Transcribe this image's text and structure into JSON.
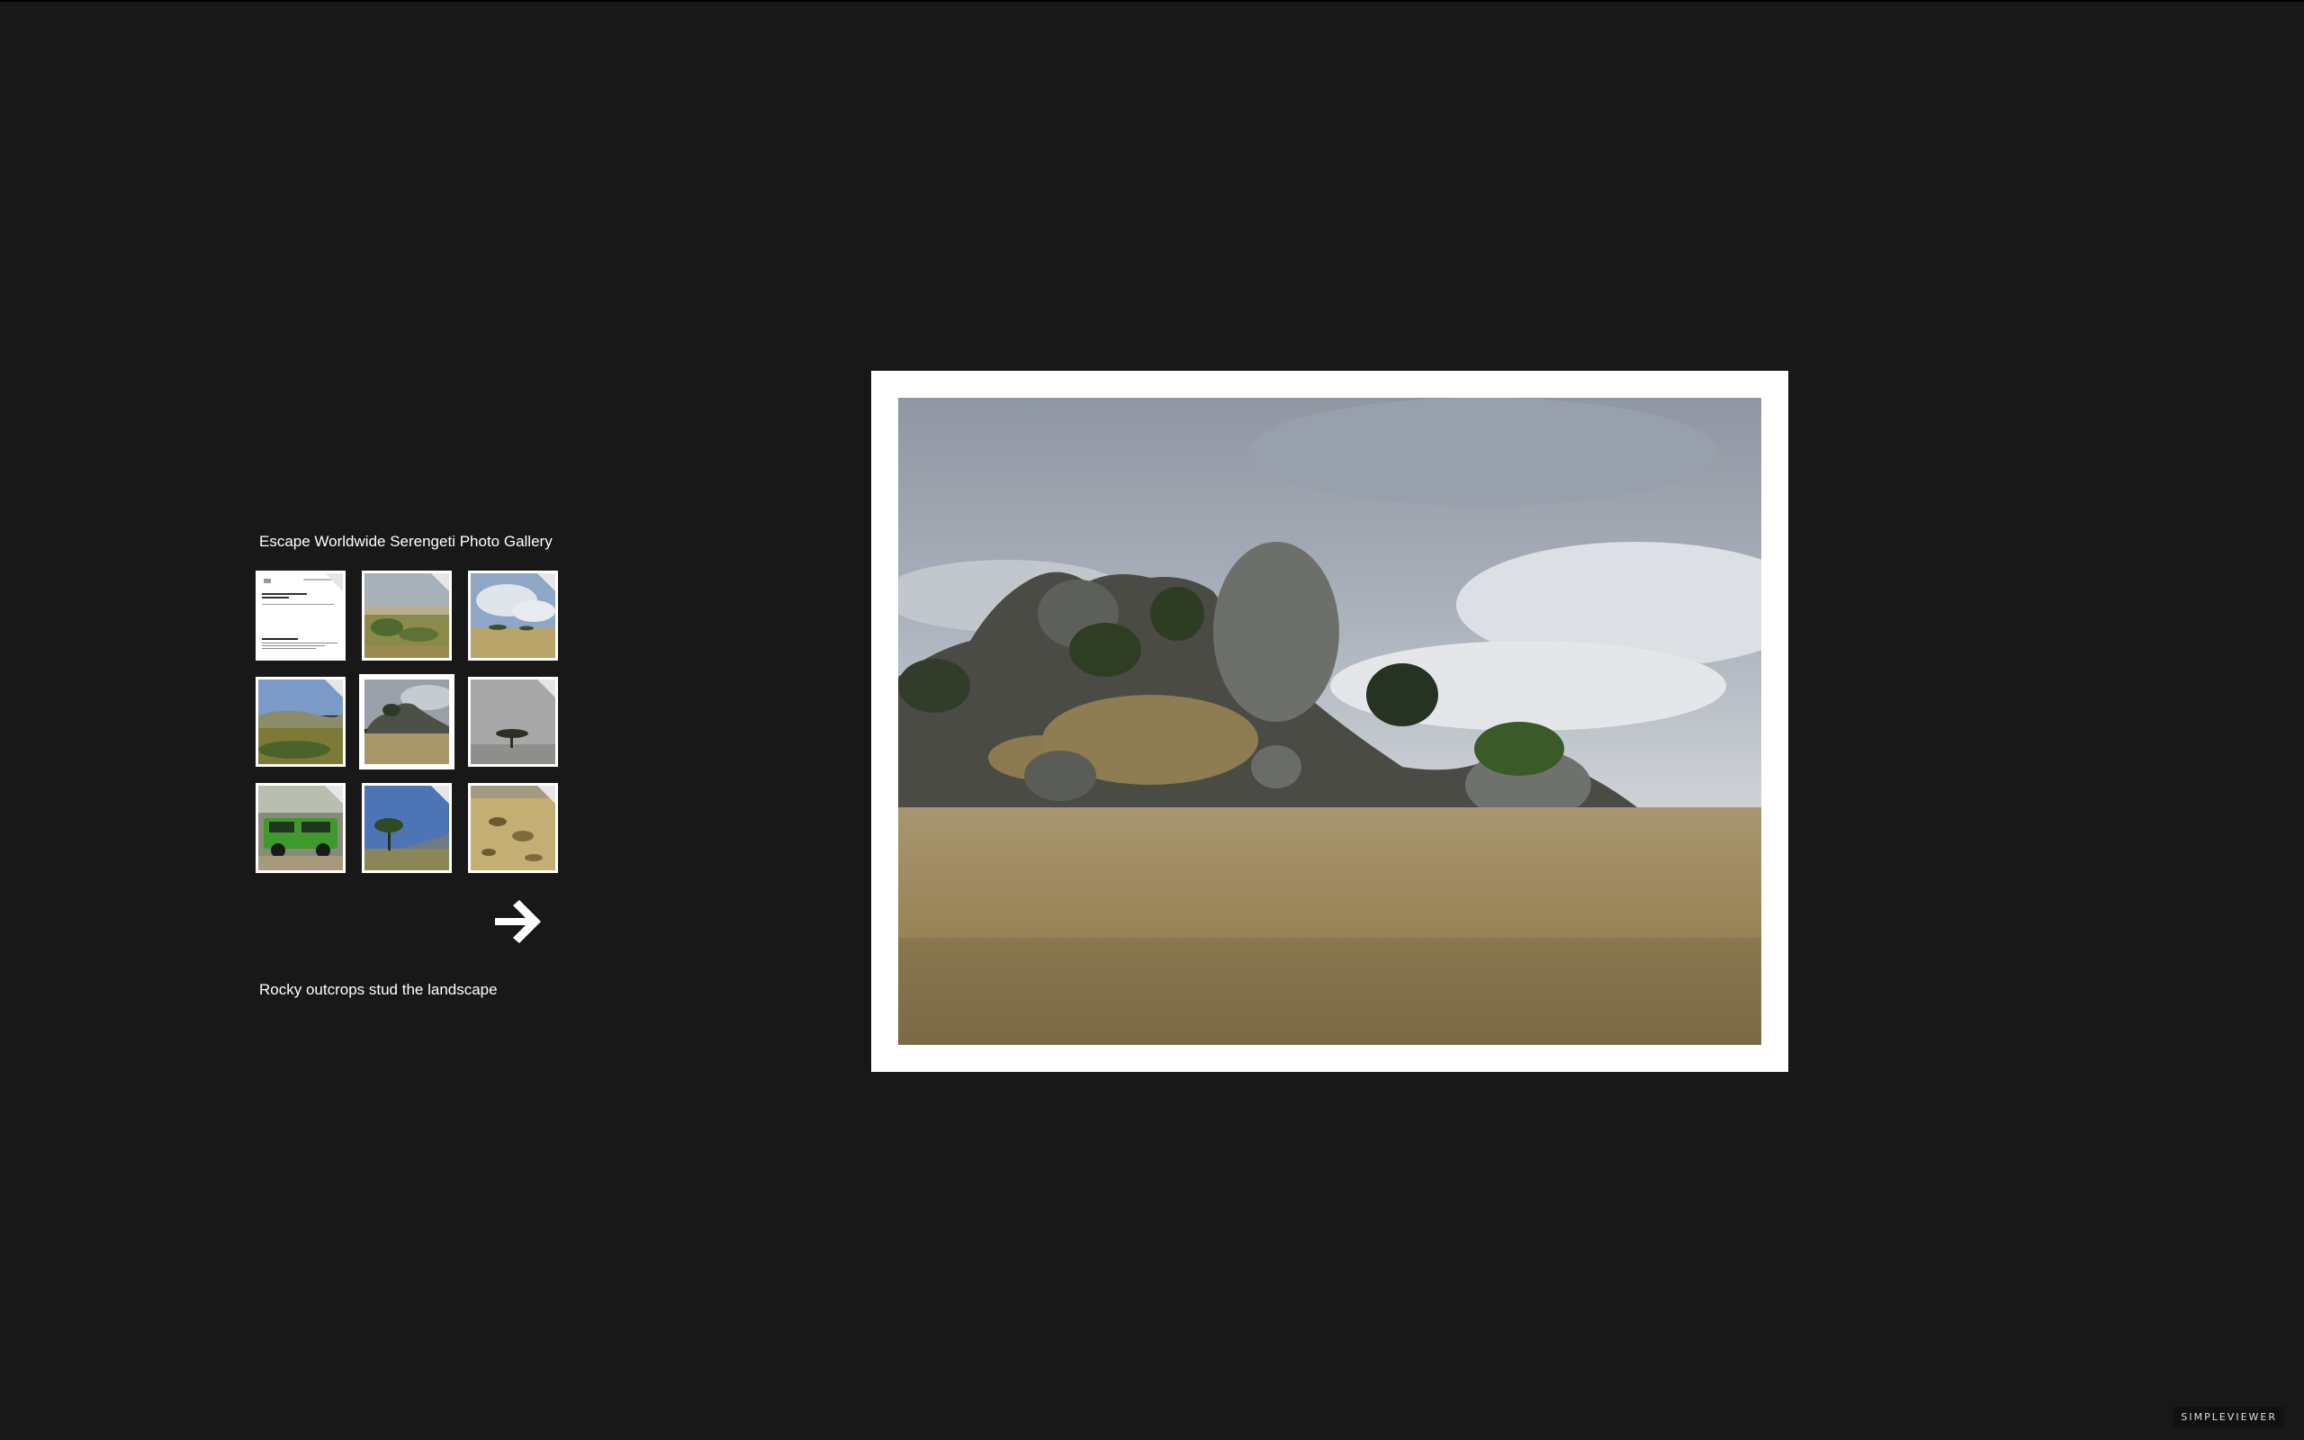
{
  "gallery": {
    "title": "Escape Worldwide Serengeti Photo Gallery",
    "caption": "Rocky outcrops stud the landscape",
    "selected_index": 4,
    "thumbnails": [
      {
        "subject": "document page"
      },
      {
        "subject": "savanna hills"
      },
      {
        "subject": "acacia under clouds"
      },
      {
        "subject": "green plain"
      },
      {
        "subject": "rocky outcrop"
      },
      {
        "subject": "lone acacia tree"
      },
      {
        "subject": "green safari vehicle"
      },
      {
        "subject": "acacia blue sky"
      },
      {
        "subject": "golden grassland"
      }
    ]
  },
  "navigation": {
    "next_icon": "arrow-right-icon"
  },
  "branding": {
    "label": "SIMPLEVIEWER"
  },
  "colors": {
    "background": "#181818",
    "frame": "#ffffff",
    "text": "#ffffff"
  }
}
